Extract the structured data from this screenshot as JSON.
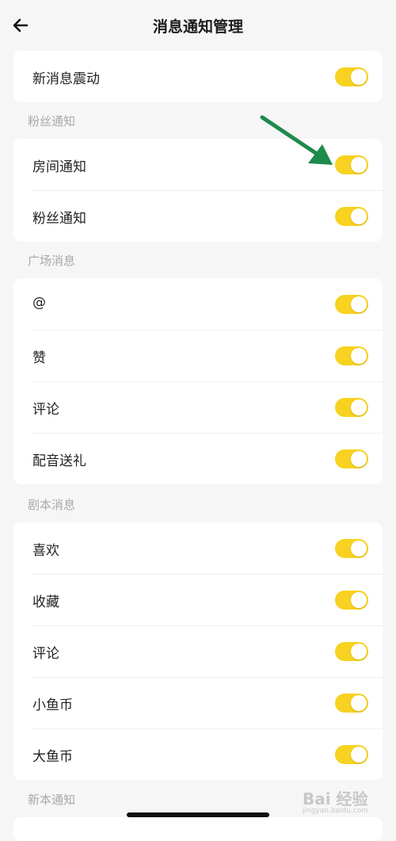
{
  "header": {
    "title": "消息通知管理"
  },
  "sections": {
    "general": {
      "items": [
        {
          "label": "新消息震动",
          "enabled": true
        }
      ]
    },
    "fans": {
      "title": "粉丝通知",
      "items": [
        {
          "label": "房间通知",
          "enabled": true
        },
        {
          "label": "粉丝通知",
          "enabled": true
        }
      ]
    },
    "plaza": {
      "title": "广场消息",
      "items": [
        {
          "label": "@",
          "enabled": true
        },
        {
          "label": "赞",
          "enabled": true
        },
        {
          "label": "评论",
          "enabled": true
        },
        {
          "label": "配音送礼",
          "enabled": true
        }
      ]
    },
    "script": {
      "title": "剧本消息",
      "items": [
        {
          "label": "喜欢",
          "enabled": true
        },
        {
          "label": "收藏",
          "enabled": true
        },
        {
          "label": "评论",
          "enabled": true
        },
        {
          "label": "小鱼币",
          "enabled": true
        },
        {
          "label": "大鱼币",
          "enabled": true
        }
      ]
    },
    "new_script": {
      "title": "新本通知"
    }
  },
  "watermark": {
    "text": "Bai 经验",
    "sub": "jingyan.baidu.com"
  },
  "colors": {
    "toggle_on": "#f8d220",
    "annotation_arrow": "#1e8a4c"
  }
}
